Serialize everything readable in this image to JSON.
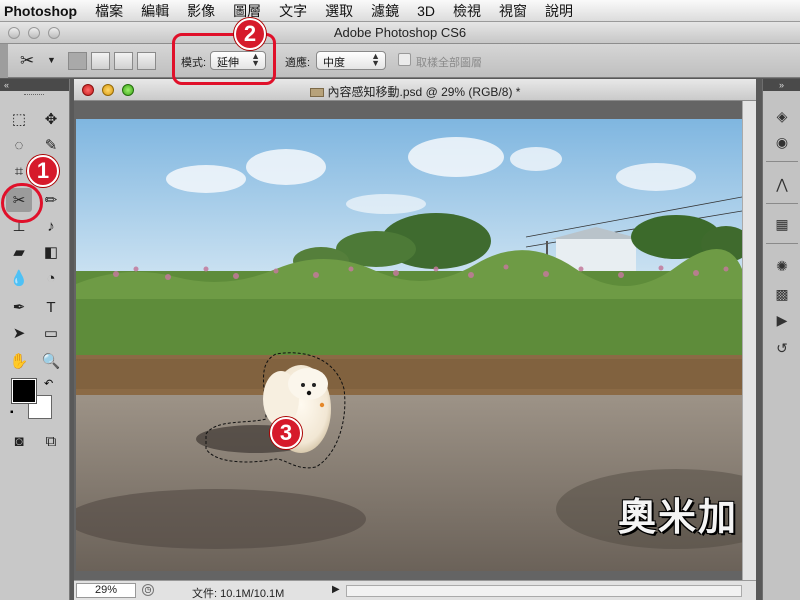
{
  "menubar": {
    "app": "Photoshop",
    "items": [
      "檔案",
      "編輯",
      "影像",
      "圖層",
      "文字",
      "選取",
      "濾鏡",
      "3D",
      "檢視",
      "視窗",
      "說明"
    ]
  },
  "window": {
    "title": "Adobe Photoshop CS6"
  },
  "options": {
    "mode_label": "模式:",
    "mode_value": "延伸",
    "adapt_label": "適應:",
    "adapt_value": "中度",
    "sample_all_label": "取樣全部圖層",
    "sample_all_checked": false
  },
  "document": {
    "title": "內容感知移動.psd @ 29% (RGB/8) *",
    "zoom": "29%",
    "file_info": "文件: 10.1M/10.1M"
  },
  "callouts": [
    "1",
    "2",
    "3"
  ],
  "watermark": "奧米加",
  "colors": {
    "callout_red": "#e0102a",
    "foreground": "#000000",
    "background": "#ffffff"
  },
  "tools": {
    "selected": "content-aware-move-tool"
  }
}
